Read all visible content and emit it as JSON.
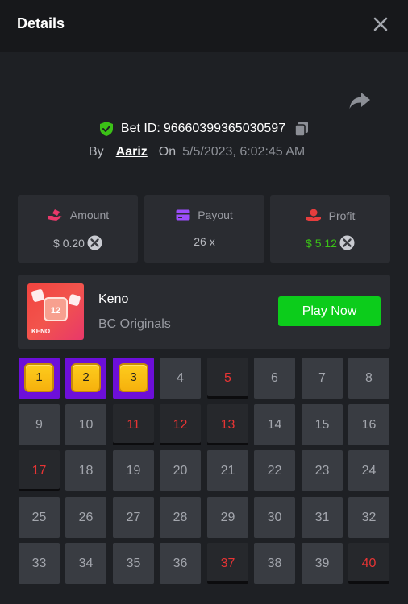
{
  "header": {
    "title": "Details"
  },
  "bet": {
    "label": "Bet ID:",
    "id": "96660399365030597",
    "by_label": "By",
    "user": "Aariz",
    "on_label": "On",
    "date": "5/5/2023, 6:02:45 AM"
  },
  "stats": {
    "amount": {
      "label": "Amount",
      "value": "$ 0.20"
    },
    "payout": {
      "label": "Payout",
      "value": "26 x"
    },
    "profit": {
      "label": "Profit",
      "value": "$ 5.12"
    }
  },
  "game": {
    "name": "Keno",
    "provider": "BC Originals",
    "play_label": "Play Now",
    "thumb_number": "12",
    "thumb_caption": "KENO"
  },
  "colors": {
    "accent_green": "#0ccc1b",
    "profit_green": "#3bc117",
    "picked_purple": "#6d0fd9",
    "hit_red": "#e73434"
  },
  "grid": {
    "cells": [
      {
        "n": "1",
        "state": "picked"
      },
      {
        "n": "2",
        "state": "picked"
      },
      {
        "n": "3",
        "state": "picked"
      },
      {
        "n": "4",
        "state": "normal"
      },
      {
        "n": "5",
        "state": "hit"
      },
      {
        "n": "6",
        "state": "normal"
      },
      {
        "n": "7",
        "state": "normal"
      },
      {
        "n": "8",
        "state": "normal"
      },
      {
        "n": "9",
        "state": "normal"
      },
      {
        "n": "10",
        "state": "normal"
      },
      {
        "n": "11",
        "state": "hit"
      },
      {
        "n": "12",
        "state": "hit"
      },
      {
        "n": "13",
        "state": "hit"
      },
      {
        "n": "14",
        "state": "normal"
      },
      {
        "n": "15",
        "state": "normal"
      },
      {
        "n": "16",
        "state": "normal"
      },
      {
        "n": "17",
        "state": "hit"
      },
      {
        "n": "18",
        "state": "normal"
      },
      {
        "n": "19",
        "state": "normal"
      },
      {
        "n": "20",
        "state": "normal"
      },
      {
        "n": "21",
        "state": "normal"
      },
      {
        "n": "22",
        "state": "normal"
      },
      {
        "n": "23",
        "state": "normal"
      },
      {
        "n": "24",
        "state": "normal"
      },
      {
        "n": "25",
        "state": "normal"
      },
      {
        "n": "26",
        "state": "normal"
      },
      {
        "n": "27",
        "state": "normal"
      },
      {
        "n": "28",
        "state": "normal"
      },
      {
        "n": "29",
        "state": "normal"
      },
      {
        "n": "30",
        "state": "normal"
      },
      {
        "n": "31",
        "state": "normal"
      },
      {
        "n": "32",
        "state": "normal"
      },
      {
        "n": "33",
        "state": "normal"
      },
      {
        "n": "34",
        "state": "normal"
      },
      {
        "n": "35",
        "state": "normal"
      },
      {
        "n": "36",
        "state": "normal"
      },
      {
        "n": "37",
        "state": "hit"
      },
      {
        "n": "38",
        "state": "normal"
      },
      {
        "n": "39",
        "state": "normal"
      },
      {
        "n": "40",
        "state": "hit"
      }
    ]
  }
}
